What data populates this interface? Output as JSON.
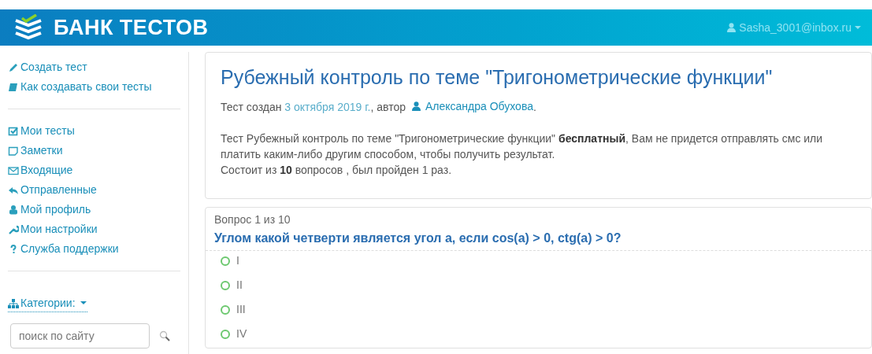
{
  "header": {
    "logo_text": "БАНК ТЕСТОВ",
    "user": "Sasha_3001@inbox.ru"
  },
  "sidebar": {
    "groups": [
      [
        "Создать тест",
        "Как создавать свои тесты"
      ],
      [
        "Мои тесты",
        "Заметки",
        "Входящие",
        "Отправленные",
        "Мой профиль",
        "Мои настройки",
        "Служба поддержки"
      ]
    ],
    "categories": "Категории:",
    "search": {
      "placeholder": "поиск по сайту"
    }
  },
  "test": {
    "title": "Рубежный контроль по теме \"Тригонометрические функции\"",
    "meta": {
      "prefix": "Тест создан ",
      "date": "3 октября 2019 г.",
      "middle": ", автор ",
      "author": "Александра Обухова",
      "suffix": "."
    },
    "description": "Тест Рубежный контроль по теме \"Тригонометрические функции\" **бесплатный**, Вам не придется отправлять смс или платить каким-либо другим способом, чтобы получить результат.",
    "summary": "Состоит из **10** вопросов , был пройден 1 раз."
  },
  "question": {
    "counter": "Вопрос 1 из 10",
    "text": "Углом какой четверти является угол а, если cos(a) > 0, ctg(a) > 0?",
    "options": [
      {
        "label": "I",
        "selected": false
      },
      {
        "label": "II",
        "selected": false
      },
      {
        "label": "III",
        "selected": false
      },
      {
        "label": "IV",
        "selected": false
      }
    ]
  }
}
